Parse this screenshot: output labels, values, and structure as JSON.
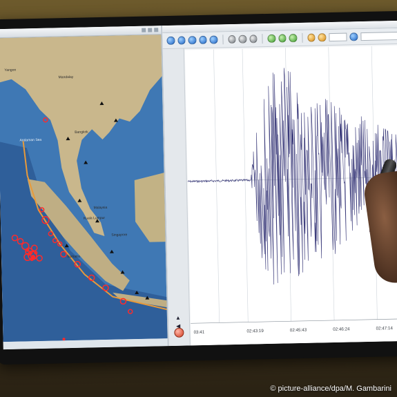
{
  "photo": {
    "credit": "© picture-alliance/dpa/M. Gambarini"
  },
  "map": {
    "labels": {
      "mandalay": "Mandalay",
      "yangon": "Yangon",
      "bangkok": "Bangkok",
      "malaysia": "Malaysia",
      "kuala_lumpur": "Kuala Lumpur",
      "singapore": "Singapore",
      "sumatra": "Sumatra",
      "andaman": "Andaman Sea"
    },
    "colors": {
      "ocean": "#3f78b4",
      "land": "#c9b78c",
      "epicenter": "#ff2a2a",
      "volcano": "#111111",
      "trench": "#e89a3a"
    }
  },
  "seismogram": {
    "axis_labels": [
      "03:41",
      "02:43:19",
      "02:45:43",
      "02:46:24",
      "02:47:14"
    ],
    "colors": {
      "trace": "#3a3a7a",
      "grid": "#cfd5db"
    }
  },
  "icons": {
    "toolbar": [
      "play-icon",
      "stop-icon",
      "zoom-in-icon",
      "zoom-out-icon",
      "refresh-icon"
    ],
    "close": "close-icon"
  }
}
